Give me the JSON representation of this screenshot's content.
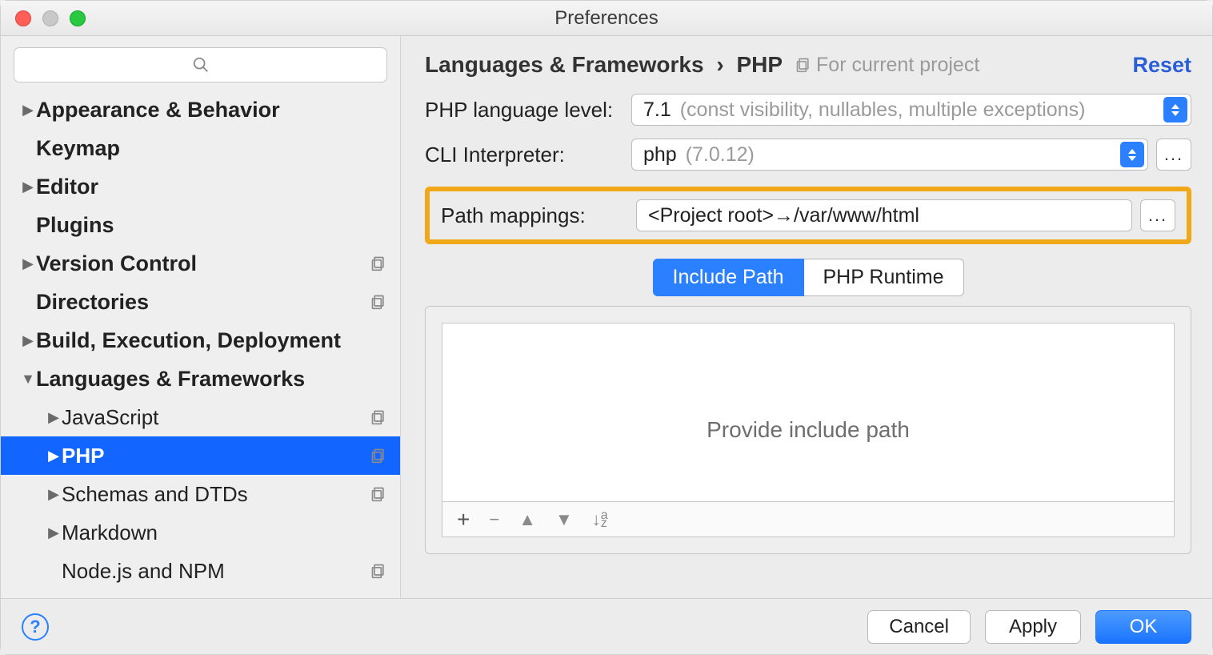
{
  "window": {
    "title": "Preferences"
  },
  "sidebar": {
    "items": [
      {
        "label": "Appearance & Behavior",
        "bold": true,
        "expand": "closed"
      },
      {
        "label": "Keymap",
        "bold": true,
        "expand": "none"
      },
      {
        "label": "Editor",
        "bold": true,
        "expand": "closed"
      },
      {
        "label": "Plugins",
        "bold": true,
        "expand": "none"
      },
      {
        "label": "Version Control",
        "bold": true,
        "expand": "closed",
        "proj": true
      },
      {
        "label": "Directories",
        "bold": true,
        "expand": "none",
        "proj": true
      },
      {
        "label": "Build, Execution, Deployment",
        "bold": true,
        "expand": "closed"
      },
      {
        "label": "Languages & Frameworks",
        "bold": true,
        "expand": "open"
      },
      {
        "label": "JavaScript",
        "child": true,
        "expand": "closed",
        "proj": true
      },
      {
        "label": "PHP",
        "child": true,
        "expand": "closed",
        "proj": true,
        "selected": true
      },
      {
        "label": "Schemas and DTDs",
        "child": true,
        "expand": "closed",
        "proj": true
      },
      {
        "label": "Markdown",
        "child": true,
        "expand": "closed"
      },
      {
        "label": "Node.js and NPM",
        "child": true,
        "expand": "none",
        "proj": true
      }
    ]
  },
  "breadcrumb": {
    "part1": "Languages & Frameworks",
    "part2": "PHP",
    "badge": "For current project"
  },
  "reset_label": "Reset",
  "form": {
    "lang_level_label": "PHP language level:",
    "lang_level_value": "7.1",
    "lang_level_hint": "(const visibility, nullables, multiple exceptions)",
    "cli_label": "CLI Interpreter:",
    "cli_value": "php",
    "cli_hint": "(7.0.12)",
    "path_label": "Path mappings:",
    "path_value": "<Project root>→/var/www/html"
  },
  "tabs": {
    "tab1": "Include Path",
    "tab2": "PHP Runtime",
    "placeholder": "Provide include path"
  },
  "footer": {
    "cancel": "Cancel",
    "apply": "Apply",
    "ok": "OK"
  }
}
